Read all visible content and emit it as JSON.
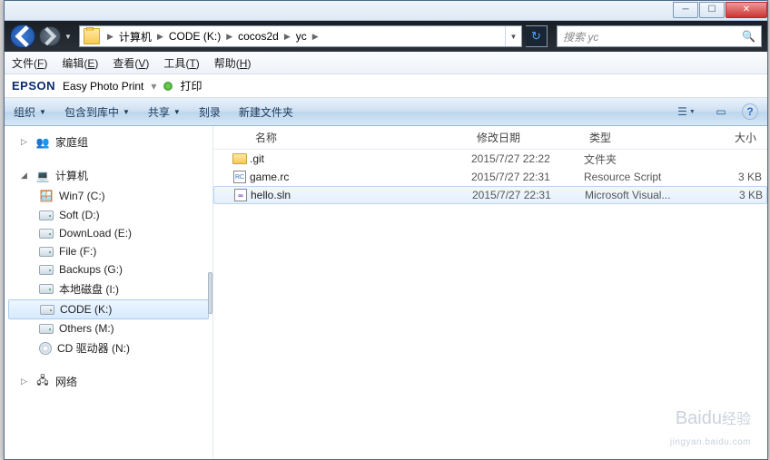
{
  "titlebar": {
    "min_tip": "Minimize",
    "max_tip": "Maximize",
    "close_tip": "Close"
  },
  "nav": {
    "breadcrumbs": [
      "计算机",
      "CODE (K:)",
      "cocos2d",
      "yc"
    ],
    "search_placeholder": "搜索 yc"
  },
  "menubar": {
    "items": [
      {
        "label": "文件",
        "key": "F"
      },
      {
        "label": "编辑",
        "key": "E"
      },
      {
        "label": "查看",
        "key": "V"
      },
      {
        "label": "工具",
        "key": "T"
      },
      {
        "label": "帮助",
        "key": "H"
      }
    ]
  },
  "epson": {
    "logo": "EPSON",
    "app": "Easy Photo Print",
    "print": "打印"
  },
  "cmdbar": {
    "organize": "组织",
    "include": "包含到库中",
    "share": "共享",
    "burn": "刻录",
    "new_folder": "新建文件夹"
  },
  "navpane": {
    "homegroup": "家庭组",
    "computer": "计算机",
    "drives": [
      {
        "label": "Win7 (C:)"
      },
      {
        "label": "Soft (D:)"
      },
      {
        "label": "DownLoad (E:)"
      },
      {
        "label": "File (F:)"
      },
      {
        "label": "Backups (G:)"
      },
      {
        "label": "本地磁盘 (I:)"
      },
      {
        "label": "CODE (K:)"
      },
      {
        "label": "Others (M:)"
      },
      {
        "label": "CD 驱动器 (N:)"
      }
    ],
    "network": "网络"
  },
  "columns": {
    "name": "名称",
    "date": "修改日期",
    "type": "类型",
    "size": "大小"
  },
  "files": [
    {
      "name": ".git",
      "date": "2015/7/27 22:22",
      "type": "文件夹",
      "size": "",
      "icon": "folder"
    },
    {
      "name": "game.rc",
      "date": "2015/7/27 22:31",
      "type": "Resource Script",
      "size": "3 KB",
      "icon": "rc"
    },
    {
      "name": "hello.sln",
      "date": "2015/7/27 22:31",
      "type": "Microsoft Visual...",
      "size": "3 KB",
      "icon": "sln",
      "selected": true
    }
  ],
  "watermark": {
    "brand": "Baidu",
    "sub": "经验",
    "url": "jingyan.baidu.com"
  }
}
